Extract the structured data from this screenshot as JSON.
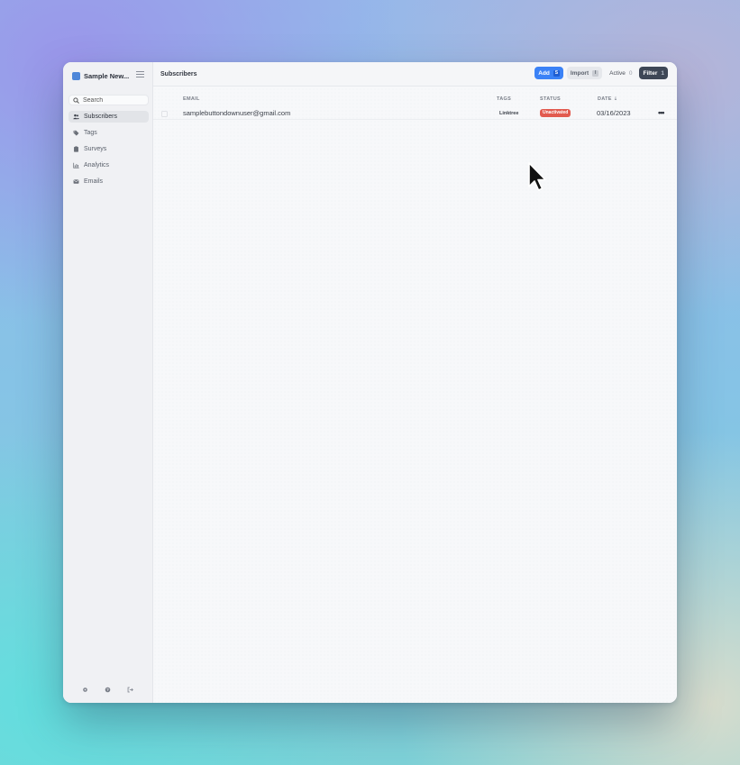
{
  "app": {
    "name": "Sample New..."
  },
  "sidebar": {
    "search_placeholder": "Search",
    "items": [
      {
        "label": "Subscribers",
        "icon": "users-icon",
        "active": true
      },
      {
        "label": "Tags",
        "icon": "tag-icon",
        "active": false
      },
      {
        "label": "Surveys",
        "icon": "clipboard-icon",
        "active": false
      },
      {
        "label": "Analytics",
        "icon": "chart-bar-icon",
        "active": false
      },
      {
        "label": "Emails",
        "icon": "envelope-icon",
        "active": false
      }
    ],
    "footer_icons": [
      "gear-icon",
      "help-icon",
      "logout-icon"
    ]
  },
  "header": {
    "title": "Subscribers",
    "add_label": "Add",
    "add_shortcut": "S",
    "import_label": "Import",
    "import_shortcut": "I",
    "active_label": "Active",
    "active_count": "0",
    "filter_label": "Filter",
    "filter_count": "1"
  },
  "table": {
    "columns": {
      "email": "EMAIL",
      "tags": "TAGS",
      "status": "STATUS",
      "date": "DATE ⇣"
    },
    "rows": [
      {
        "email": "samplebuttondownuser@gmail.com",
        "tag": "Linktree",
        "status": "Unactivated",
        "date": "03/16/2023",
        "more": "•••"
      }
    ]
  },
  "colors": {
    "accent": "#3b82f6",
    "status_unactivated": "#e25a4f",
    "filter_bg": "#3e4756"
  }
}
